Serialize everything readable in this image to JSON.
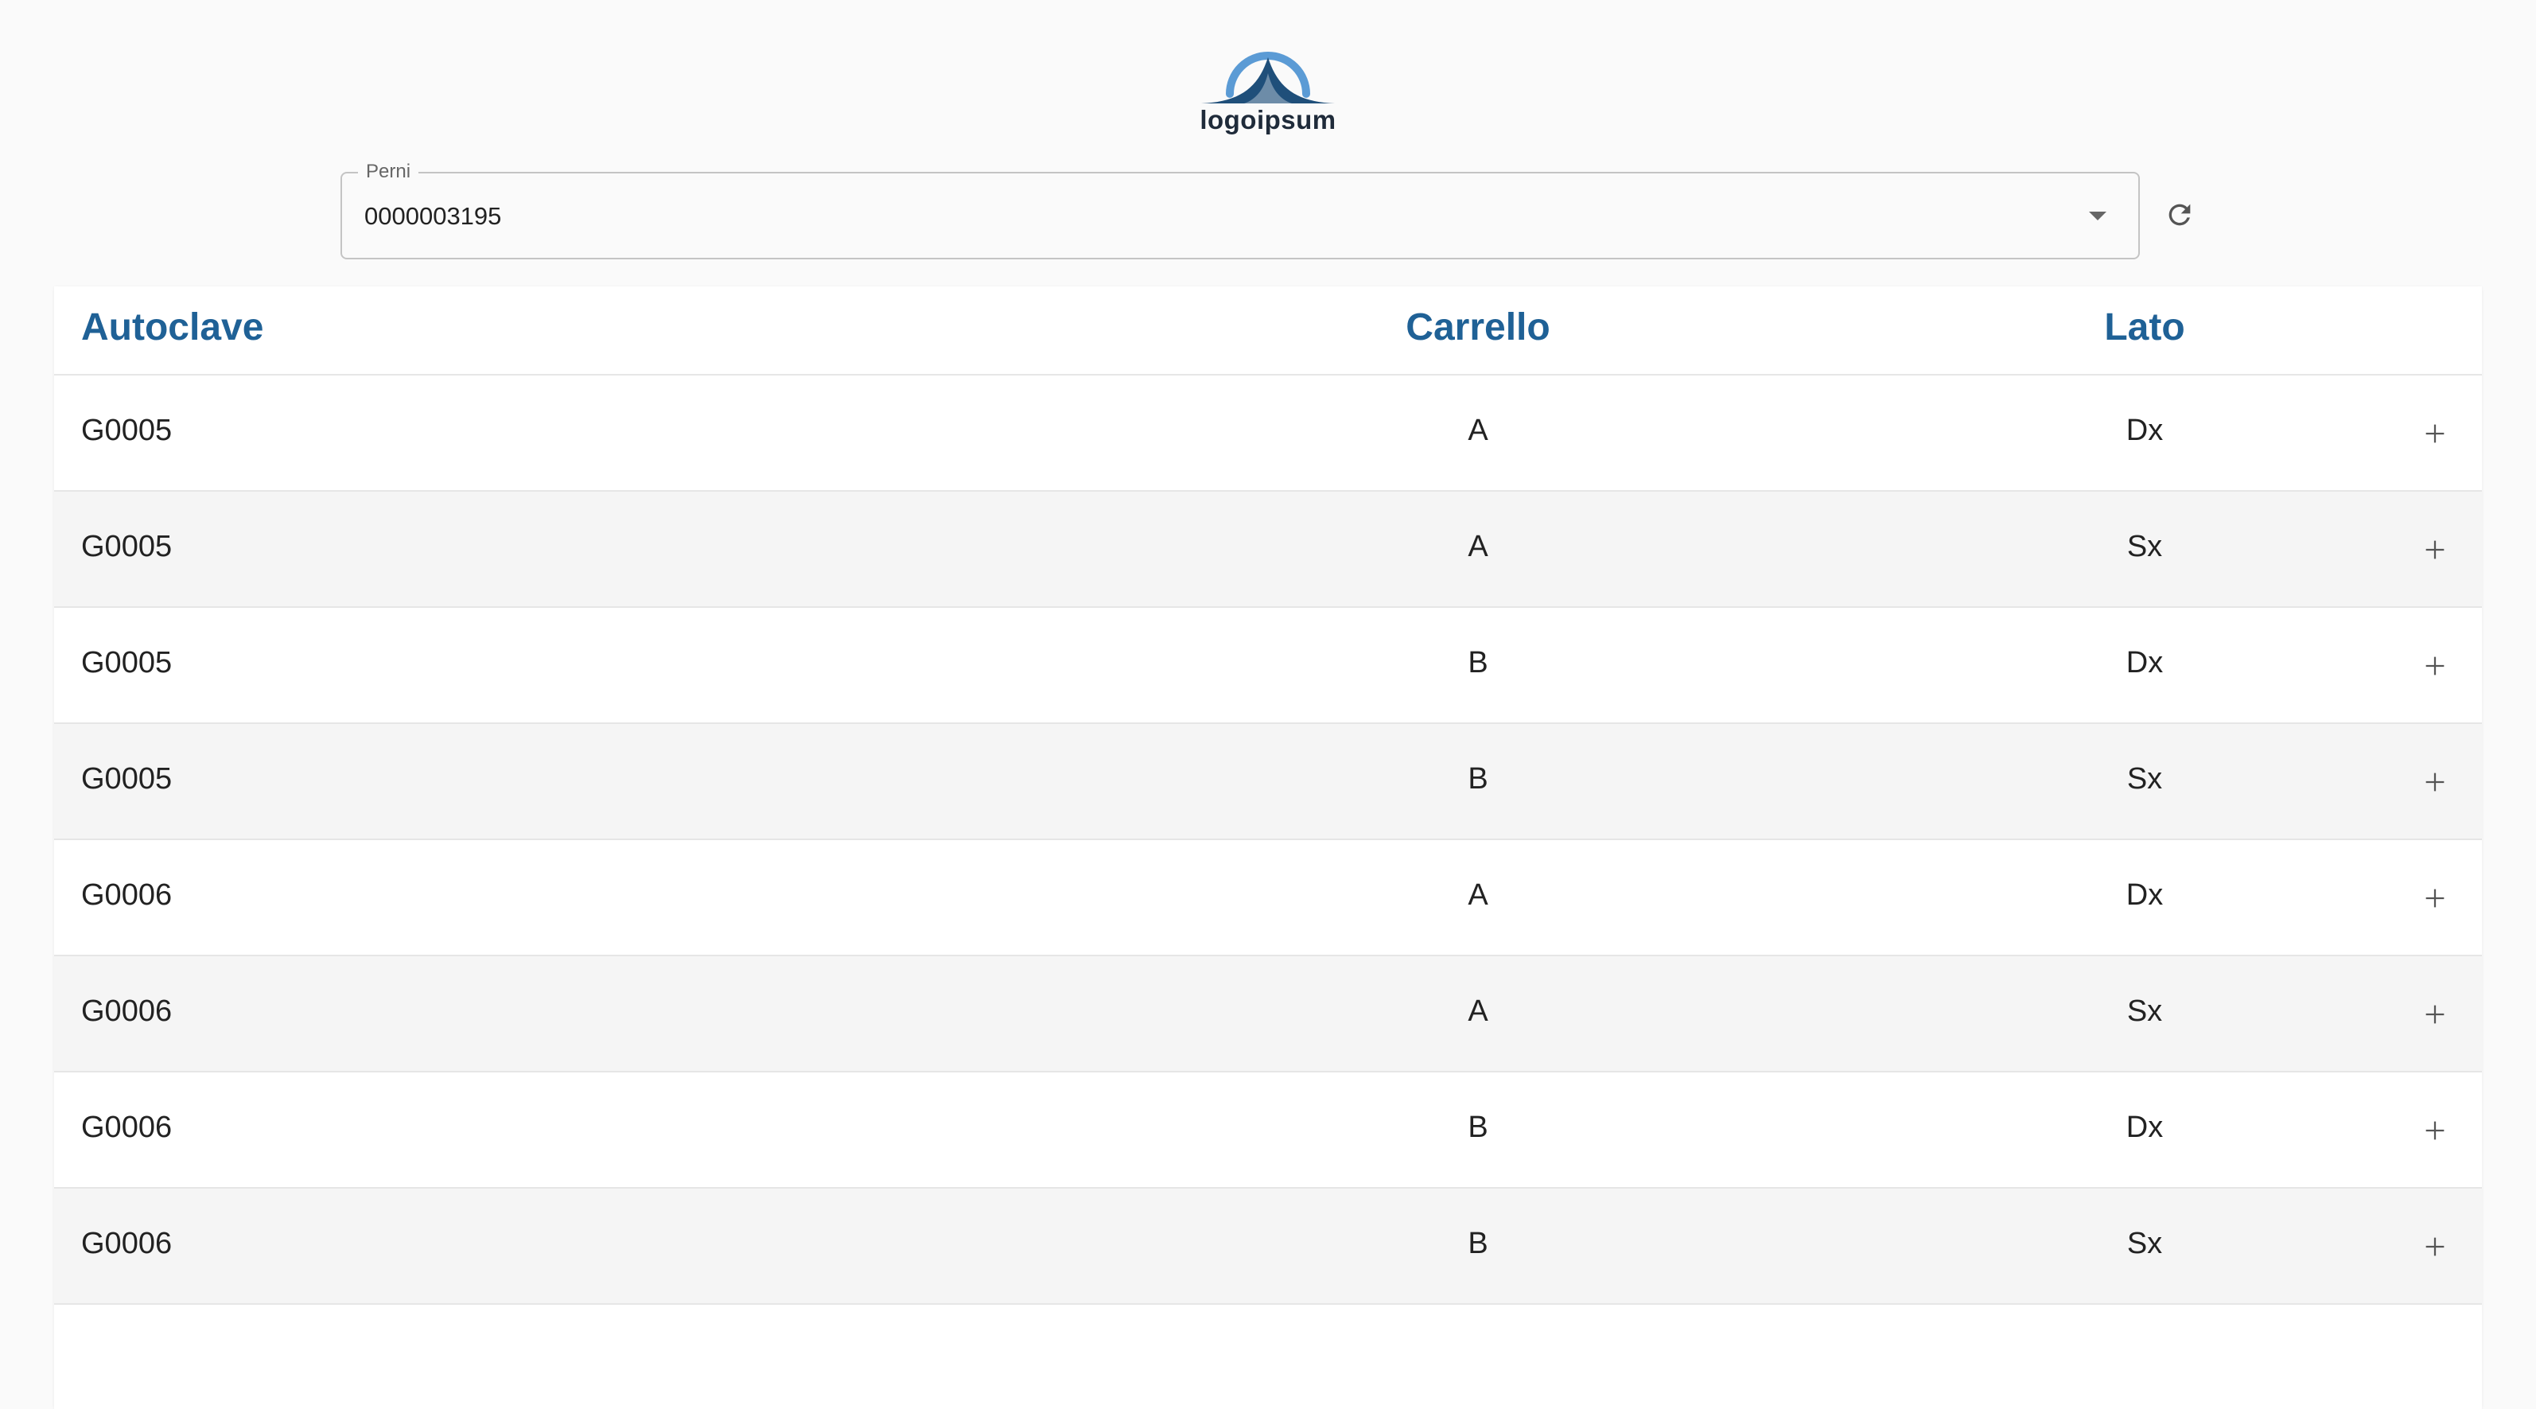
{
  "logo": {
    "text": "logoipsum",
    "colors": {
      "arc": "#5b9bd5",
      "peak": "#1f4f7a"
    }
  },
  "filter": {
    "label": "Perni",
    "value": "0000003195",
    "arrow_icon": "arrow-drop-down-icon"
  },
  "refresh": {
    "icon": "refresh-icon"
  },
  "table": {
    "headers": {
      "autoclave": "Autoclave",
      "carrello": "Carrello",
      "lato": "Lato"
    },
    "header_color": "#1f6196",
    "row_action_icon": "add-icon",
    "rows": [
      {
        "autoclave": "G0005",
        "carrello": "A",
        "lato": "Dx"
      },
      {
        "autoclave": "G0005",
        "carrello": "A",
        "lato": "Sx"
      },
      {
        "autoclave": "G0005",
        "carrello": "B",
        "lato": "Dx"
      },
      {
        "autoclave": "G0005",
        "carrello": "B",
        "lato": "Sx"
      },
      {
        "autoclave": "G0006",
        "carrello": "A",
        "lato": "Dx"
      },
      {
        "autoclave": "G0006",
        "carrello": "A",
        "lato": "Sx"
      },
      {
        "autoclave": "G0006",
        "carrello": "B",
        "lato": "Dx"
      },
      {
        "autoclave": "G0006",
        "carrello": "B",
        "lato": "Sx"
      }
    ]
  }
}
